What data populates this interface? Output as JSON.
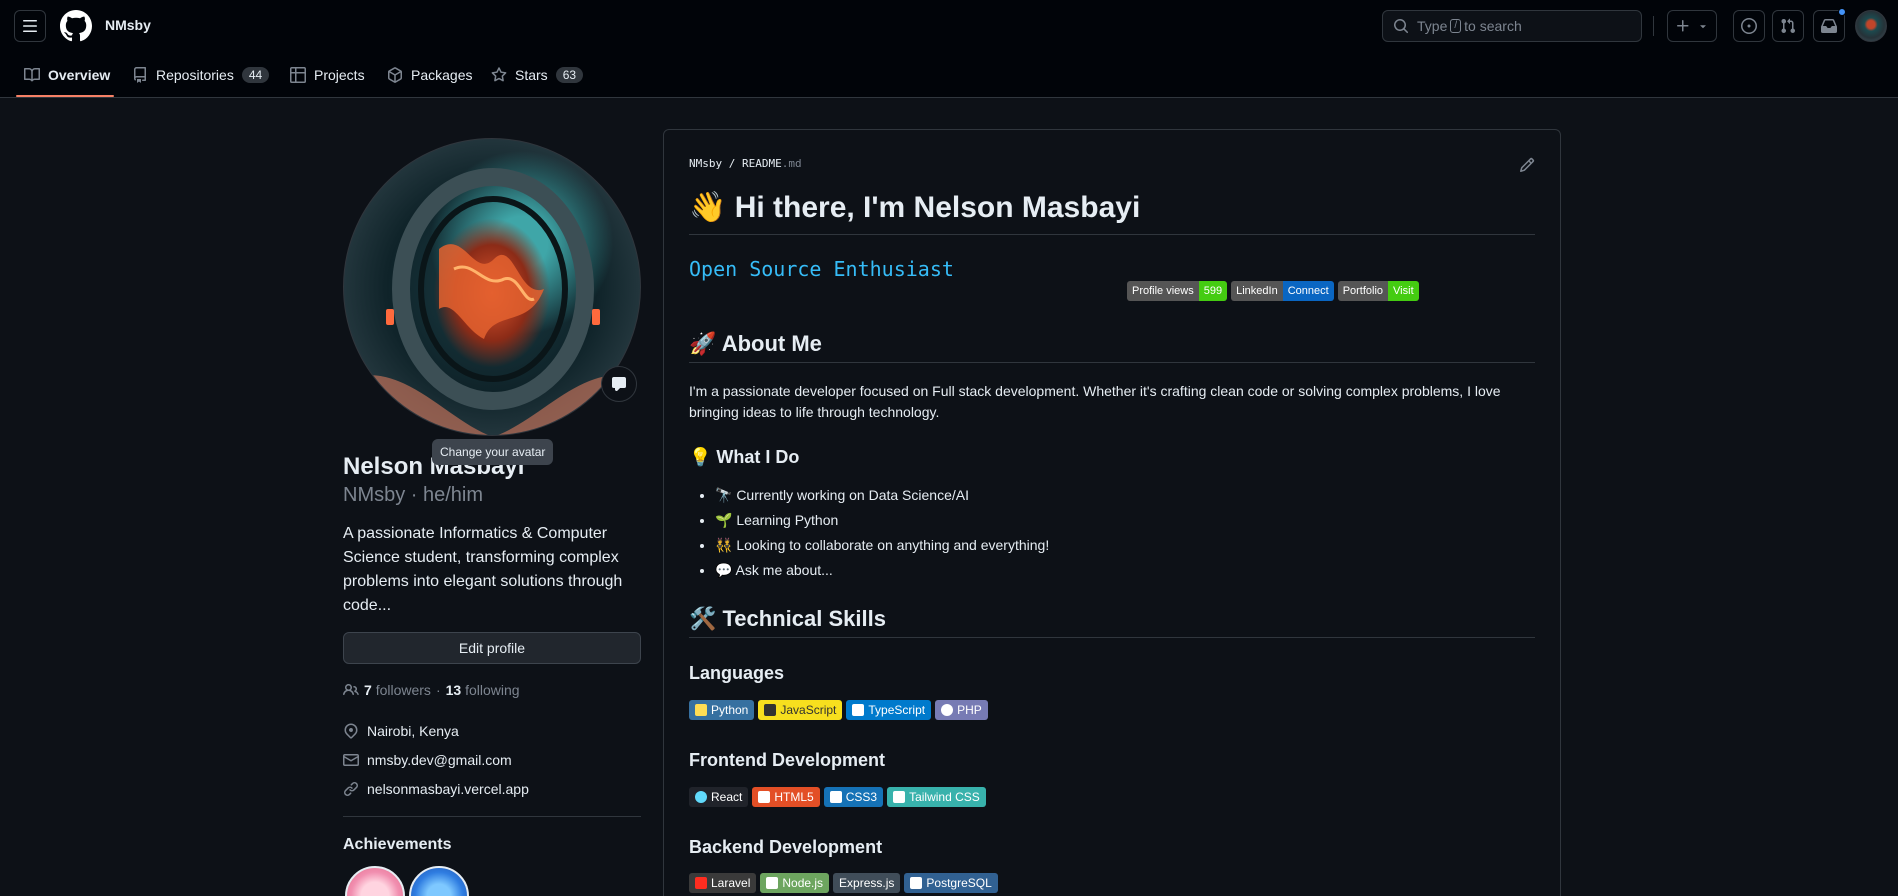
{
  "header": {
    "owner": "NMsby",
    "search_placeholder_pre": "Type",
    "search_slash": "/",
    "search_placeholder_post": "to search"
  },
  "tabs": [
    {
      "label": "Overview",
      "count": null
    },
    {
      "label": "Repositories",
      "count": "44"
    },
    {
      "label": "Projects",
      "count": null
    },
    {
      "label": "Packages",
      "count": null
    },
    {
      "label": "Stars",
      "count": "63"
    }
  ],
  "profile": {
    "tooltip": "Change your avatar",
    "name": "Nelson Masbayi",
    "login": "NMsby · he/him",
    "bio": "A passionate Informatics & Computer Science student, transforming complex problems into elegant solutions through code...",
    "edit_label": "Edit profile",
    "followers": "7",
    "followers_label": "followers",
    "dot": "·",
    "following": "13",
    "following_label": "following",
    "location": "Nairobi, Kenya",
    "email": "nmsby.dev@gmail.com",
    "website": "nelsonmasbayi.vercel.app",
    "achievements_title": "Achievements"
  },
  "readme": {
    "crumb_user": "NMsby",
    "crumb_sep": "/",
    "crumb_file": "README",
    "crumb_ext": ".md",
    "title": "👋 Hi there, I'm Nelson Masbayi",
    "typing": "Open Source Enthusiast",
    "badges": [
      {
        "label": "Profile views",
        "value": "599",
        "color": "#4c1"
      },
      {
        "label": "LinkedIn",
        "value": "Connect",
        "color": "#0a66c2"
      },
      {
        "label": "Portfolio",
        "value": "Visit",
        "color": "#4c1"
      }
    ],
    "about_title": "🚀 About Me",
    "about_text": "I'm a passionate developer focused on Full stack development. Whether it's crafting clean code or solving complex problems, I love bringing ideas to life through technology.",
    "whatido_title": "💡 What I Do",
    "whatido": [
      "🔭 Currently working on Data Science/AI",
      "🌱 Learning Python",
      "👯 Looking to collaborate on anything and everything!",
      "💬 Ask me about..."
    ],
    "skills_title": "🛠️ Technical Skills",
    "languages_title": "Languages",
    "languages": [
      {
        "label": "Python",
        "bg": "#3670a0",
        "fg": "#ffffff",
        "icon": "#ffdd54"
      },
      {
        "label": "JavaScript",
        "bg": "#f7df1e",
        "fg": "#323330",
        "icon": "#323330"
      },
      {
        "label": "TypeScript",
        "bg": "#007acc",
        "fg": "#ffffff",
        "icon": "#ffffff"
      },
      {
        "label": "PHP",
        "bg": "#777bb4",
        "fg": "#ffffff",
        "icon": "#ffffff"
      }
    ],
    "frontend_title": "Frontend Development",
    "frontend": [
      {
        "label": "React",
        "bg": "#20232a",
        "fg": "#ffffff",
        "icon": "#61dafb"
      },
      {
        "label": "HTML5",
        "bg": "#e34f26",
        "fg": "#ffffff",
        "icon": "#ffffff"
      },
      {
        "label": "CSS3",
        "bg": "#1572b6",
        "fg": "#ffffff",
        "icon": "#ffffff"
      },
      {
        "label": "Tailwind CSS",
        "bg": "#38b2ac",
        "fg": "#ffffff",
        "icon": "#ffffff"
      }
    ],
    "backend_title": "Backend Development",
    "backend": [
      {
        "label": "Laravel",
        "bg": "#3a3a3a",
        "fg": "#ffffff",
        "icon": "#ff2d20"
      },
      {
        "label": "Node.js",
        "bg": "#6da55f",
        "fg": "#ffffff",
        "icon": "#ffffff"
      },
      {
        "label": "Express.js",
        "bg": "#404d59",
        "fg": "#ffffff",
        "icon": null
      },
      {
        "label": "PostgreSQL",
        "bg": "#316192",
        "fg": "#ffffff",
        "icon": "#ffffff"
      }
    ]
  },
  "colors": {
    "accent_tab": "#f78166",
    "link_blue": "#4493f8",
    "typing_cyan": "#36bcf7"
  }
}
